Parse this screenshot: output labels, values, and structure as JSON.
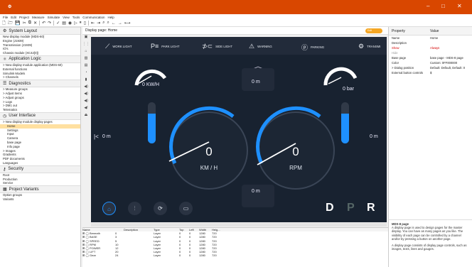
{
  "window": {
    "minimize": "–",
    "maximize": "□",
    "close": "✕"
  },
  "menu": [
    "File",
    "Edit",
    "Project",
    "Measure",
    "Simulate",
    "View",
    "Tools",
    "Communication",
    "Help"
  ],
  "sections": {
    "system_layout": "System Layout",
    "app_logic": "Application Logic",
    "diagnostics": "Diagnostics",
    "user_interface": "User Interface",
    "security": "Security",
    "project_variants": "Project Variants"
  },
  "system_items": [
    "New display module (MDS-60)",
    "Engine (J1939)",
    "Transmission (J1939)",
    "IO's",
    "Chassis module (XC42[0])"
  ],
  "logic_items": [
    "> New display module application (MDS-60)",
    "External functions",
    "Simulink Models",
    "> Channels"
  ],
  "diag_items": [
    "> Measure groups",
    "> Adjust items",
    "> Adjust groups",
    "> Logs",
    "> DM1 out",
    "Telematics"
  ],
  "ui_items": [
    "> New display module display pages",
    "Home",
    "Settings",
    "Input",
    "Camera",
    "base page",
    "Info page",
    "> Images",
    "Gradients",
    "PDF documents",
    "Languages"
  ],
  "security_items": [
    "Root",
    "Production",
    "Service"
  ],
  "variant_items": [
    "Option groups",
    "Variants"
  ],
  "center": {
    "title": "Display page: Home",
    "toggle": "Edit"
  },
  "dash": {
    "work_light": "WORK LIGHT",
    "park_light": "PARK LIGHT",
    "side_light": "SIDE LIGHT",
    "warning": "WARNING",
    "parking": "PARKING",
    "transmission": "TRANSMI",
    "kmh_small": "0 KW/H",
    "bar_small": "0 bar",
    "speed_val": "0",
    "speed_unit": "KM / H",
    "rpm_val": "0",
    "rpm_unit": "RPM",
    "top_box": "0 m",
    "bottom_box": "0 m",
    "left_box": "0 m",
    "right_box": "0 m",
    "gear_d": "D",
    "gear_p": "P",
    "gear_r": "R",
    "left_level": 0.72,
    "right_level": 0.72
  },
  "props": {
    "col_prop": "Property",
    "col_val": "Value",
    "rows": [
      [
        "Name",
        "Home"
      ],
      [
        "Description",
        ""
      ],
      [
        "Show",
        "Always"
      ],
      [
        "Hide",
        ""
      ],
      [
        "Base page",
        "base page - MDS-8 page"
      ],
      [
        "Color",
        "Custom: 0FF000000"
      ],
      [
        "> Dialog position",
        "Default: Default, Default: 0"
      ],
      [
        "External button controls",
        "$"
      ]
    ]
  },
  "info": {
    "title": "MDS-8 page",
    "p1": "A display page is used to design pages for the master display. You can have as many pages as you like. The visibility of each page can be controlled by a channel and/or by pressing a button on another page.",
    "p2": "A display page consists of display page controls, such as images, texts, lines and gauges."
  },
  "layers": {
    "headers": [
      "Name",
      "",
      "Description",
      "Type",
      "Top",
      "Left",
      "Width",
      "Heig..."
    ],
    "rows": [
      [
        "Beneath",
        "0",
        "",
        "Layer",
        "0",
        "0",
        "1280",
        "720"
      ],
      [
        "BASE",
        "3",
        "",
        "Layer",
        "0",
        "0",
        "1280",
        "720"
      ],
      [
        "SPEED",
        "5",
        "",
        "Layer",
        "0",
        "0",
        "1280",
        "720"
      ],
      [
        "RPM",
        "10",
        "",
        "Layer",
        "0",
        "0",
        "1280",
        "720"
      ],
      [
        "POWER",
        "12",
        "",
        "Layer",
        "0",
        "0",
        "1280",
        "720"
      ],
      [
        "LIFT",
        "20",
        "",
        "Layer",
        "0",
        "0",
        "1280",
        "720"
      ],
      [
        "Gear",
        "24",
        "",
        "Layer",
        "0",
        "0",
        "1280",
        "720"
      ]
    ]
  }
}
